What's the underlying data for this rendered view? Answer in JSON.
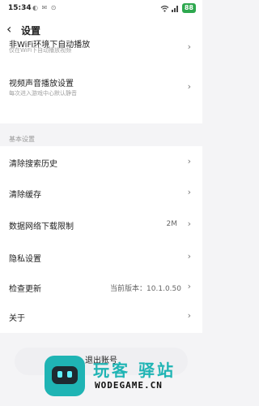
{
  "status_bar": {
    "time": "15:34",
    "notification_icons": "◐ ✉ ⊙",
    "wifi_icon": "wifi-icon",
    "battery": "88"
  },
  "header": {
    "back_icon": "chevron-left-icon",
    "title": "设置"
  },
  "video_settings": [
    {
      "title": "非WiFi环境下自动播放",
      "subtitle": "仅在WiFi下自动播放视频"
    },
    {
      "title": "视频声音播放设置",
      "subtitle": "每次进入游戏中心默认静音"
    }
  ],
  "basic_section": {
    "label": "基本设置",
    "items": [
      {
        "label": "清除搜索历史",
        "value": ""
      },
      {
        "label": "清除缓存",
        "value": ""
      },
      {
        "label": "数据网络下载限制",
        "value": "2M"
      },
      {
        "label": "隐私设置",
        "value": ""
      },
      {
        "label": "检查更新",
        "value": "当前版本：10.1.0.50"
      },
      {
        "label": "关于",
        "value": ""
      }
    ]
  },
  "logout_label": "退出账号",
  "watermark": {
    "name": "玩客 驿站",
    "site": "WODEGAME.CN"
  },
  "colors": {
    "watermark_teal": "#1fb4b4",
    "battery_green": "#2ea84f"
  }
}
